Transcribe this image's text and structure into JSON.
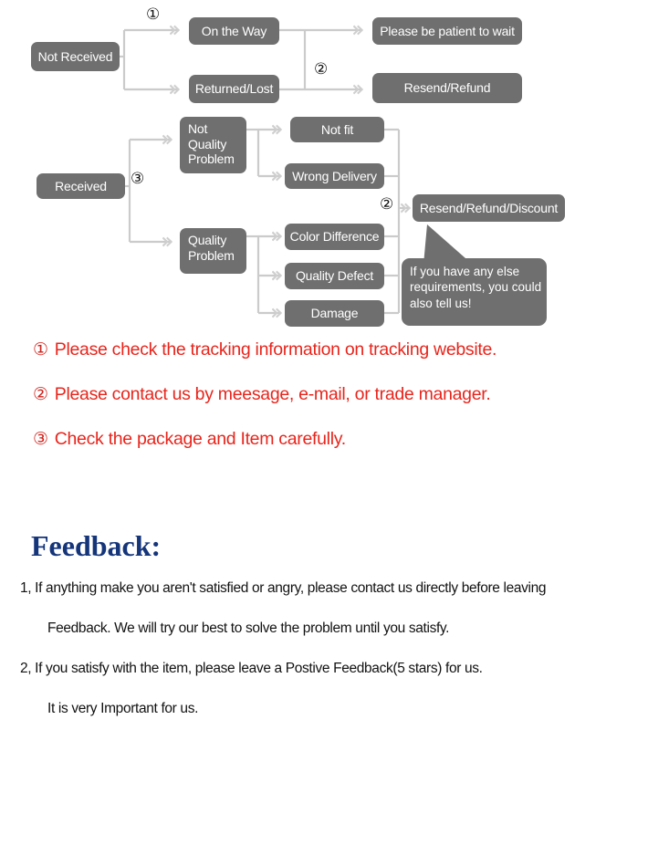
{
  "flowchart": {
    "nodes": {
      "not_received": {
        "label": "Not Received"
      },
      "on_the_way": {
        "label": "On the Way"
      },
      "returned_lost": {
        "label": "Returned/Lost"
      },
      "please_wait": {
        "label": "Please be patient to wait"
      },
      "resend_refund": {
        "label": "Resend/Refund"
      },
      "received": {
        "label": "Received"
      },
      "not_quality_l1": {
        "label": "Not"
      },
      "not_quality_l2": {
        "label": "Quality"
      },
      "not_quality_l3": {
        "label": "Problem"
      },
      "not_fit": {
        "label": "Not fit"
      },
      "wrong_delivery": {
        "label": "Wrong Delivery"
      },
      "quality_problem_l1": {
        "label": "Quality"
      },
      "quality_problem_l2": {
        "label": "Problem"
      },
      "color_difference": {
        "label": "Color Difference"
      },
      "quality_defect": {
        "label": "Quality Defect"
      },
      "damage": {
        "label": "Damage"
      },
      "resend_refund_disc": {
        "label": "Resend/Refund/Discount"
      }
    },
    "bubble": {
      "line1": "If you have any else",
      "line2": "requirements, you could",
      "line3": "also tell us!"
    },
    "markers": {
      "one_top": "①",
      "two_top": "②",
      "three_left": "③",
      "two_right": "②"
    },
    "colors": {
      "node_fill": "#706f6f",
      "node_text": "#ffffff",
      "connector": "#c9c9c9"
    }
  },
  "notes": [
    {
      "num": "①",
      "text": "Please check the tracking information on tracking website."
    },
    {
      "num": "②",
      "text": "Please contact us by meesage, e-mail, or trade manager."
    },
    {
      "num": "③",
      "text": "Check the package and Item carefully."
    }
  ],
  "notes_color": "#e8251c",
  "feedback": {
    "title": "Feedback:",
    "title_color": "#15357a",
    "lines": [
      {
        "text": "1, If anything make you aren't satisfied or angry, please contact us directly before leaving",
        "indent": false
      },
      {
        "text": "Feedback. We will try our best to solve the problem until you satisfy.",
        "indent": true
      },
      {
        "text": "2, If you satisfy with the item, please leave a Postive Feedback(5 stars) for us.",
        "indent": false
      },
      {
        "text": "It is very Important for us.",
        "indent": true
      }
    ]
  }
}
